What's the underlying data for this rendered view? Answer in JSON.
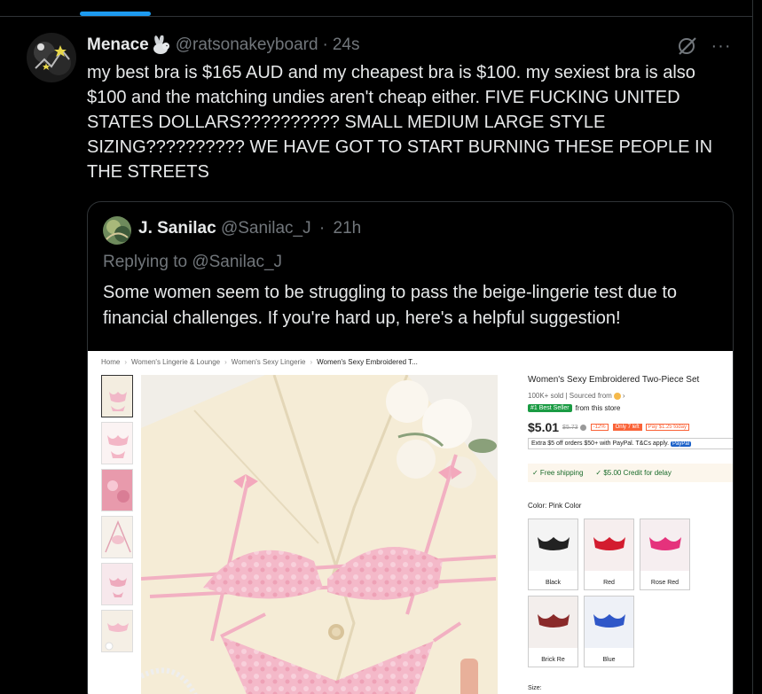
{
  "tweet": {
    "display_name": "Menace",
    "handle": "@ratsonakeyboard",
    "separator": "·",
    "time": "24s",
    "text": "my best bra is $165 AUD and my cheapest bra is $100. my sexiest bra is also $100 and the matching undies aren't cheap either. FIVE FUCKING UNITED STATES DOLLARS?????????? SMALL MEDIUM LARGE STYLE SIZING?????????? WE HAVE GOT TO START BURNING THESE PEOPLE IN THE STREETS",
    "more_label": "···"
  },
  "quote": {
    "display_name": "J. Sanilac",
    "handle": "@Sanilac_J",
    "separator": "·",
    "time": "21h",
    "replying": "Replying to @Sanilac_J",
    "text": "Some women seem to be struggling to pass the beige-lingerie test due to financial challenges. If you're hard up, here's a helpful suggestion!"
  },
  "product": {
    "breadcrumb": [
      "Home",
      "Women's Lingerie & Lounge",
      "Women's Sexy Lingerie",
      "Women's Sexy Embroidered T..."
    ],
    "title": "Women's Sexy Embroidered Two-Piece Set",
    "sold": "100K+ sold",
    "sourced": "| Sourced from",
    "best_seller": "#1 Best Seller",
    "best_seller_suffix": "from this store",
    "price": "$5.01",
    "old_price": "$5.73",
    "discount": "-12%",
    "left": "Only 7 left",
    "pay_today": "Pay $1.25 today",
    "paypal_text": "Extra $5 off orders $50+ with PayPal. T&Cs apply.",
    "paypal_logo": "PayPal",
    "free_shipping": "✓ Free shipping",
    "credit": "✓ $5.00 Credit for delay",
    "color_label": "Color: Pink Color",
    "swatches": [
      "Black",
      "Red",
      "Rose Red",
      "Brick Re",
      "Blue"
    ],
    "size_label": "Size:"
  },
  "colors": {
    "accent": "#1d9bf0",
    "background": "#000000",
    "text": "#e7e9ea",
    "muted": "#71767b",
    "border": "#2f3336"
  }
}
